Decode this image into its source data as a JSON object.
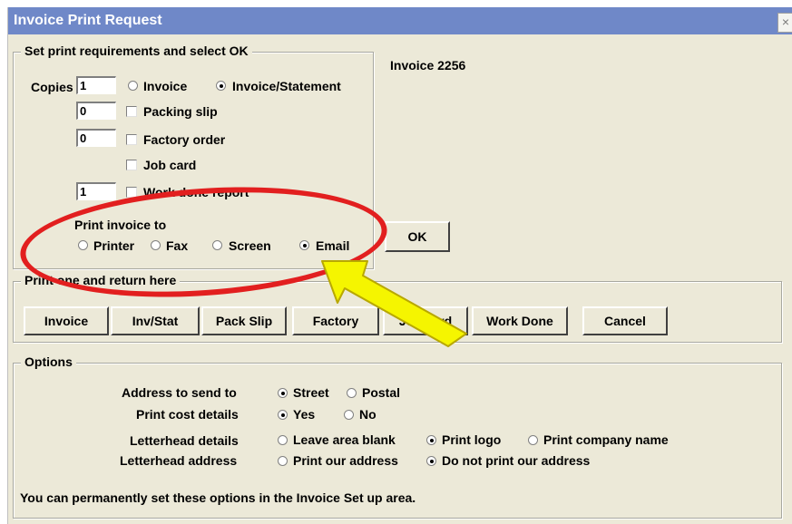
{
  "window": {
    "title": "Invoice Print Request",
    "close_glyph": "×"
  },
  "print_group": {
    "legend": "Set print requirements and select OK",
    "copies_label": "Copies",
    "copies_value": "1",
    "invoice_radio_label": "Invoice",
    "invoice_statement_radio_label": "Invoice/Statement",
    "packing_slip_value": "0",
    "packing_slip_label": "Packing slip",
    "factory_order_value": "0",
    "factory_order_label": "Factory order",
    "job_card_label": "Job card",
    "work_done_value": "1",
    "work_done_label": "Work done report",
    "print_to_label": "Print invoice to",
    "printer_label": "Printer",
    "fax_label": "Fax",
    "screen_label": "Screen",
    "email_label": "Email"
  },
  "invoice_number_text": "Invoice 2256",
  "ok_label": "OK",
  "print_one": {
    "legend": "Print one and return here",
    "buttons": [
      "Invoice",
      "Inv/Stat",
      "Pack Slip",
      "Factory",
      "Job card",
      "Work Done",
      "Cancel"
    ]
  },
  "options": {
    "legend": "Options",
    "address_label": "Address to send to",
    "street_label": "Street",
    "postal_label": "Postal",
    "cost_label": "Print cost details",
    "yes_label": "Yes",
    "no_label": "No",
    "letterhead_details_label": "Letterhead details",
    "leave_blank_label": "Leave area blank",
    "print_logo_label": "Print logo",
    "print_company_label": "Print company name",
    "letterhead_address_label": "Letterhead address",
    "print_our_address_label": "Print our address",
    "do_not_print_label": "Do not print our address",
    "footer_note": "You can permanently set these options in the Invoice Set up area."
  },
  "colors": {
    "titlebar": "#6f88c8",
    "dialog_bg": "#ece9d8",
    "annotation_ellipse": "#e21f1f",
    "annotation_arrow": "#f5f500"
  }
}
